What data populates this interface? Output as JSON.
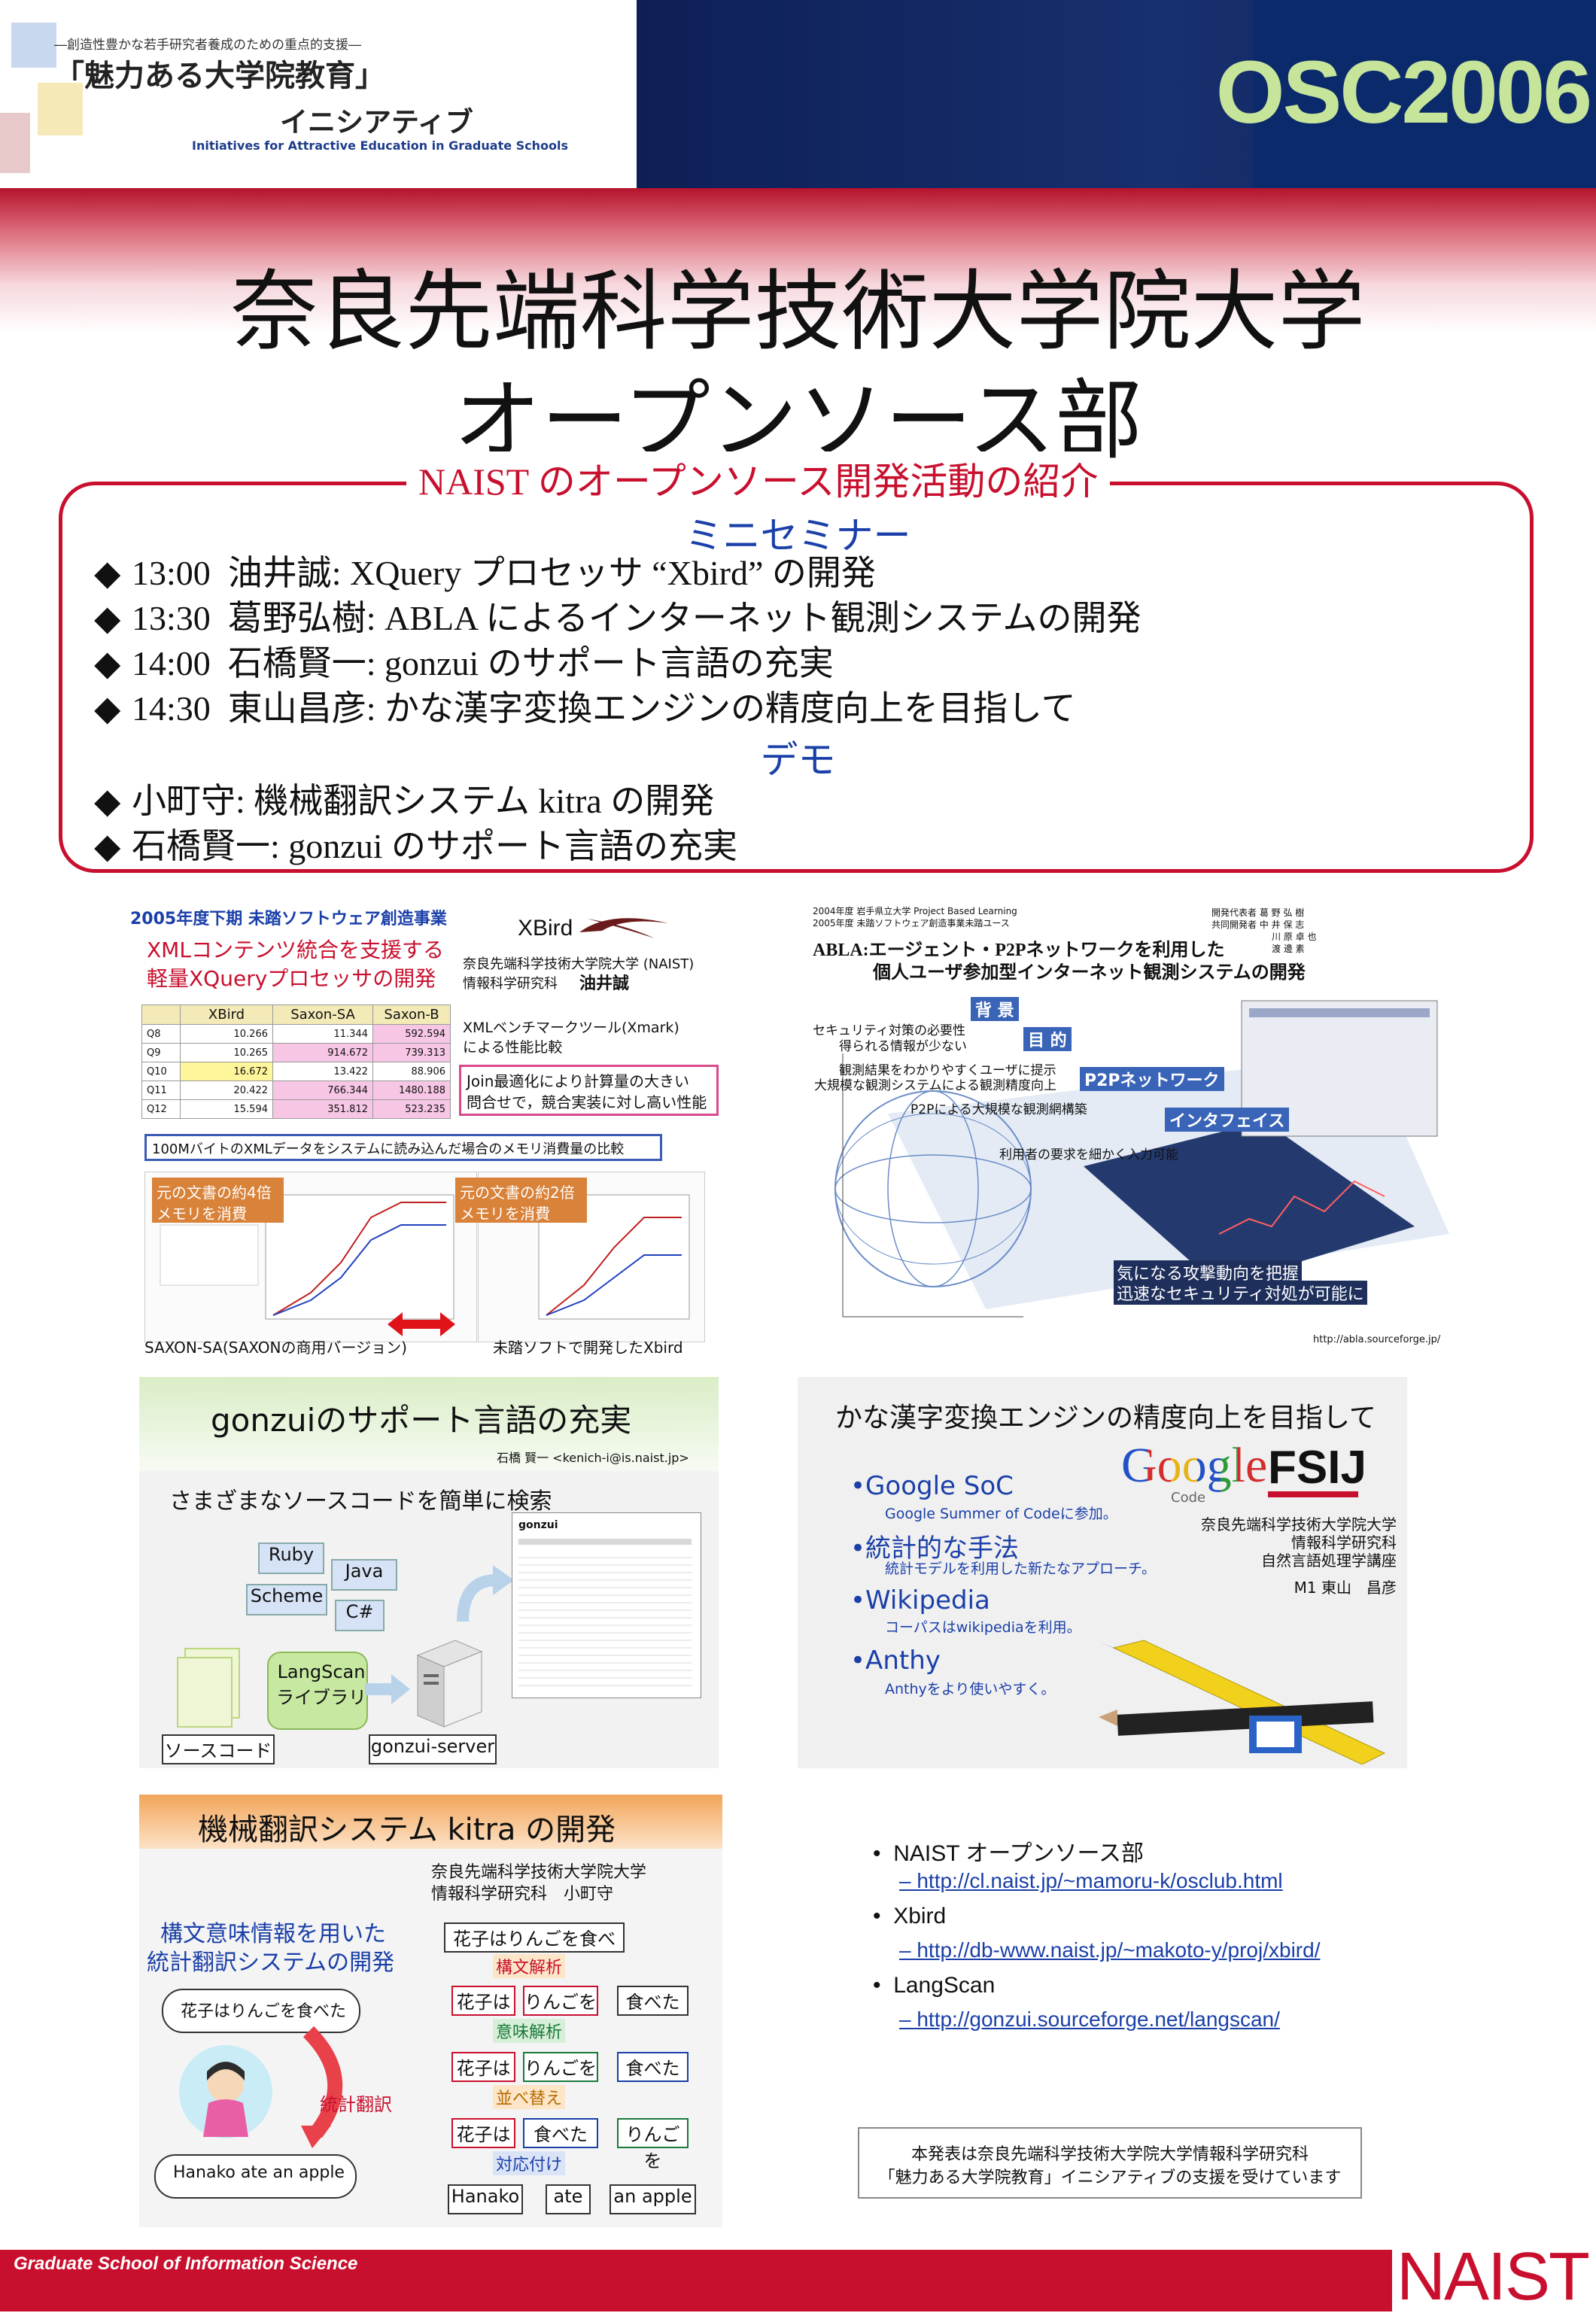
{
  "header": {
    "subtitle": "―創造性豊かな若手研究者養成のための重点的支援―",
    "program_name": "「魅力ある大学院教育」",
    "initiative": "イニシアティブ",
    "initiative_en": "Initiatives for Attractive Education in Graduate Schools",
    "event": "OSC2006"
  },
  "title": {
    "line1": "奈良先端科学技術大学院大学",
    "line2": "オープンソース部"
  },
  "program": {
    "title": "NAIST のオープンソース開発活動の紹介",
    "seminar_heading": "ミニセミナー",
    "seminar": [
      {
        "time": "13:00",
        "text": "油井誠: XQuery プロセッサ “Xbird” の開発"
      },
      {
        "time": "13:30",
        "text": "葛野弘樹: ABLA によるインターネット観測システムの開発"
      },
      {
        "time": "14:00",
        "text": "石橋賢一: gonzui のサポート言語の充実"
      },
      {
        "time": "14:30",
        "text": "東山昌彦: かな漢字変換エンジンの精度向上を目指して"
      }
    ],
    "demo_heading": "デモ",
    "demo": [
      "小町守: 機械翻訳システム kitra の開発",
      "石橋賢一: gonzui のサポート言語の充実"
    ],
    "bullet": "◆"
  },
  "xbird": {
    "project": "2005年度下期 未踏ソフトウェア創造事業",
    "headline1": "XMLコンテンツ統合を支援する",
    "headline2": "軽量XQueryプロセッサの開発",
    "logo": "XBird",
    "affil1": "奈良先端科学技術大学院大学 (NAIST)",
    "affil2": "情報科学研究科",
    "author": "油井誠",
    "bench1": "XMLベンチマークツール(Xmark)",
    "bench2": "による性能比較",
    "join1": "Join最適化により計算量の大きい",
    "join2": "問合せで，競合実装に対し高い性能",
    "table_headers": [
      "",
      "XBird",
      "Saxon-SA",
      "Saxon-B"
    ],
    "table_rows": [
      [
        "Q8",
        "10.266",
        "11.344",
        "592.594"
      ],
      [
        "Q9",
        "10.265",
        "914.672",
        "739.313"
      ],
      [
        "Q10",
        "16.672",
        "13.422",
        "88.906"
      ],
      [
        "Q11",
        "20.422",
        "766.344",
        "1480.188"
      ],
      [
        "Q12",
        "15.594",
        "351.812",
        "523.235"
      ]
    ],
    "memory_note": "100MバイトのXMLデータをシステムに読み込んだ場合のメモリ消費量の比較",
    "left_note1": "元の文書の約4倍",
    "left_note2": "メモリを消費",
    "right_note1": "元の文書の約2倍",
    "right_note2": "メモリを消費",
    "left_caption": "SAXON-SA(SAXONの商用バージョン)",
    "right_caption": "未踏ソフトで開発したXbird"
  },
  "abla": {
    "meta1": "2004年度 岩手県立大学 Project Based Learning",
    "meta2": "2005年度 未踏ソフトウェア創造事業未踏ユース",
    "title1": "ABLA:エージェント・P2Pネットワークを利用した",
    "title2": "個人ユーザ参加型インターネット観測システムの開発",
    "label_bg": "背 景",
    "label_goal": "目 的",
    "label_p2p": "P2Pネットワーク",
    "label_if": "インタフェイス",
    "note_bg1": "セキュリティ対策の必要性",
    "note_bg2": "得られる情報が少ない",
    "note_goal1": "観測結果をわかりやすくユーザに提示",
    "note_goal2": "大規模な観測システムによる観測精度向上",
    "note_p2p": "P2Pによる大規模な観測網構築",
    "note_if": "利用者の要求を細かく入力可能",
    "note_end1": "気になる攻撃動向を把握",
    "note_end2": "迅速なセキュリティ対処が可能に",
    "url": "http://abla.sourceforge.jp/",
    "team": [
      "開発代表者 葛 野 弘 樹",
      "共同開発者 中 井 保 志",
      "川 原 卓 也",
      "渡 邊 素"
    ]
  },
  "gonzui": {
    "title": "gonzuiのサポート言語の充実",
    "author": "石橋 賢一 <kenich-i@is.naist.jp>",
    "lead": "さまざまなソースコードを簡単に検索",
    "langs": [
      "Ruby",
      "Java",
      "Scheme",
      "C#"
    ],
    "lib": "LangScan\nライブラリ",
    "source": "ソースコード",
    "server": "gonzui-server",
    "screen_title": "gonzui"
  },
  "kana": {
    "title": "かな漢字変換エンジンの精度向上を目指して",
    "items": [
      {
        "head": "•Google SoC",
        "sub": "Google Summer of Codeに参加。"
      },
      {
        "head": "•統計的な手法",
        "sub": "統計モデルを利用した新たなアプローチ。"
      },
      {
        "head": "•Wikipedia",
        "sub": "コーパスはwikipediaを利用。"
      },
      {
        "head": "•Anthy",
        "sub": "Anthyをより使いやすく。"
      }
    ],
    "google": "Google",
    "google_code": "Code",
    "fsij": "FSIJ",
    "affil1": "奈良先端科学技術大学院大学",
    "affil2": "情報科学研究科",
    "affil3": "自然言語処理学講座",
    "author": "M1 東山　昌彦"
  },
  "kitra": {
    "title": "機械翻訳システム kitra の開発",
    "affil1": "奈良先端科学技術大学院大学",
    "affil2": "情報科学研究科　小町守",
    "lead1": "構文意味情報を用いた",
    "lead2": "統計翻訳システムの開発",
    "bubble_in": "花子はりんごを食べた",
    "bubble_out": "Hanako ate an apple",
    "stat_label": "統計翻訳",
    "sentence": "花子はりんごを食べた",
    "step1": "構文解析",
    "step2": "意味解析",
    "step3": "並べ替え",
    "step4": "対応付け",
    "row1": [
      "花子は",
      "りんごを",
      "食べた"
    ],
    "row2": [
      "花子は",
      "りんごを",
      "食べた"
    ],
    "row3": [
      "花子は",
      "食べた",
      "りんごを"
    ],
    "row4": [
      "Hanako",
      "ate",
      "an apple"
    ]
  },
  "links": [
    {
      "name": "NAIST オープンソース部",
      "url": "– http://cl.naist.jp/~mamoru-k/osclub.html"
    },
    {
      "name": "Xbird",
      "url": "– http://db-www.naist.jp/~makoto-y/proj/xbird/"
    },
    {
      "name": "LangScan",
      "url": "– http://gonzui.sourceforge.net/langscan/"
    }
  ],
  "acknowledgement": {
    "line1": "本発表は奈良先端科学技術大学院大学情報科学研究科",
    "line2": "「魅力ある大学院教育」イニシアティブの支援を受けています"
  },
  "footer": {
    "school": "Graduate School of Information Science",
    "logo": "NAIST"
  },
  "colors": {
    "accent": "#c8102e",
    "blue": "#1a3fa8",
    "navy": "#0e1f55",
    "osc": "#c6e49a"
  }
}
